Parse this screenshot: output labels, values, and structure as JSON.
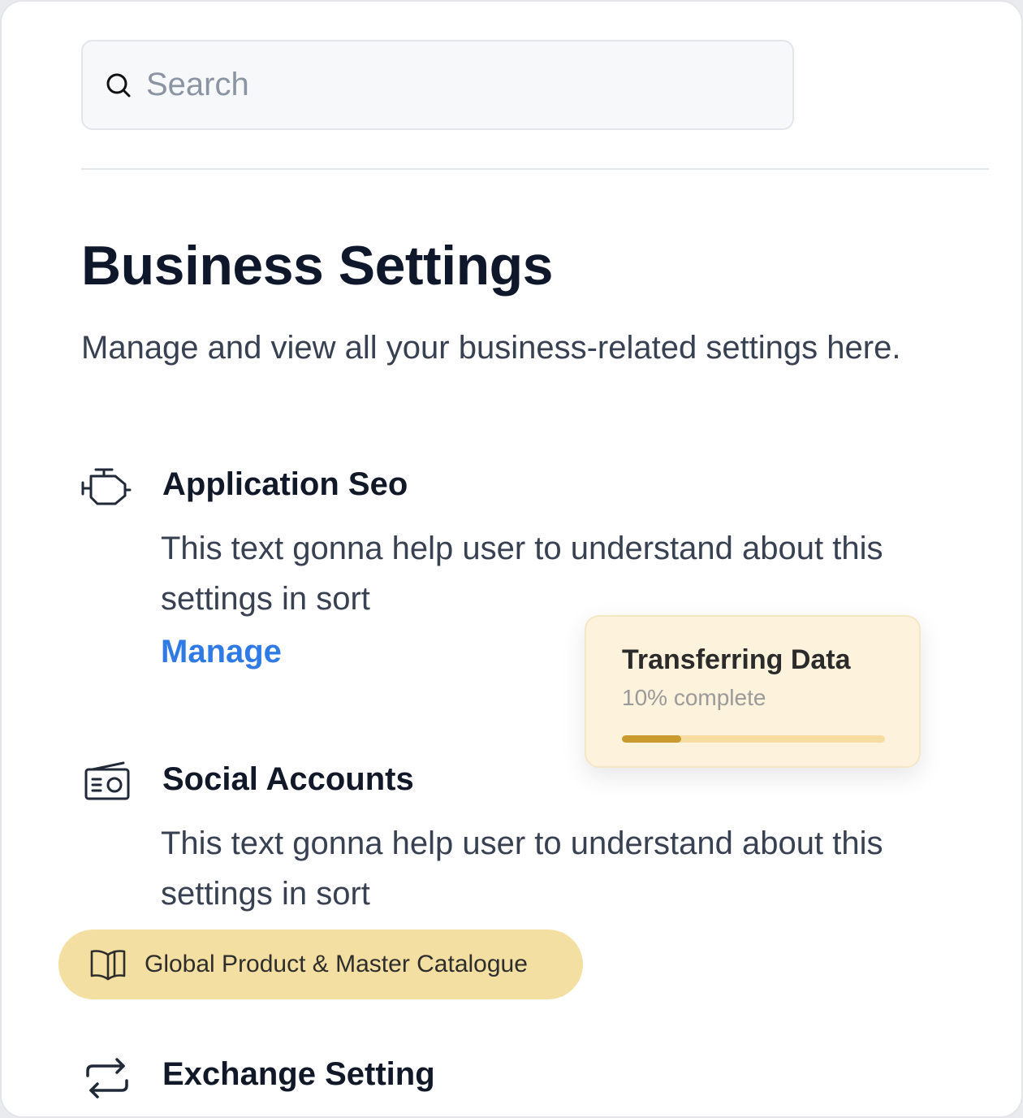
{
  "search": {
    "placeholder": "Search"
  },
  "page": {
    "title": "Business Settings",
    "subtitle": "Manage and view all your business-related settings here."
  },
  "settings": [
    {
      "title": "Application Seo",
      "description": "This text gonna help user to understand about this settings in sort",
      "link_label": "Manage",
      "icon": "engine-icon"
    },
    {
      "title": "Social Accounts",
      "description": "This text gonna help user to understand about this settings in sort",
      "icon": "radio-icon"
    },
    {
      "title": "Exchange Setting",
      "icon": "exchange-icon"
    }
  ],
  "toast": {
    "title": "Transferring Data",
    "status": "10% complete",
    "progress_fraction": 0.1,
    "colors": {
      "background": "#fdf3dc",
      "track": "#f6dca0",
      "fill": "#c99a2e"
    }
  },
  "catalogue_pill": {
    "label": "Global Product & Master Catalogue",
    "icon": "book-open-icon",
    "color": "#f4dfa2"
  },
  "colors": {
    "link": "#2f7ae5",
    "title": "#0f172a",
    "text": "#374151"
  }
}
